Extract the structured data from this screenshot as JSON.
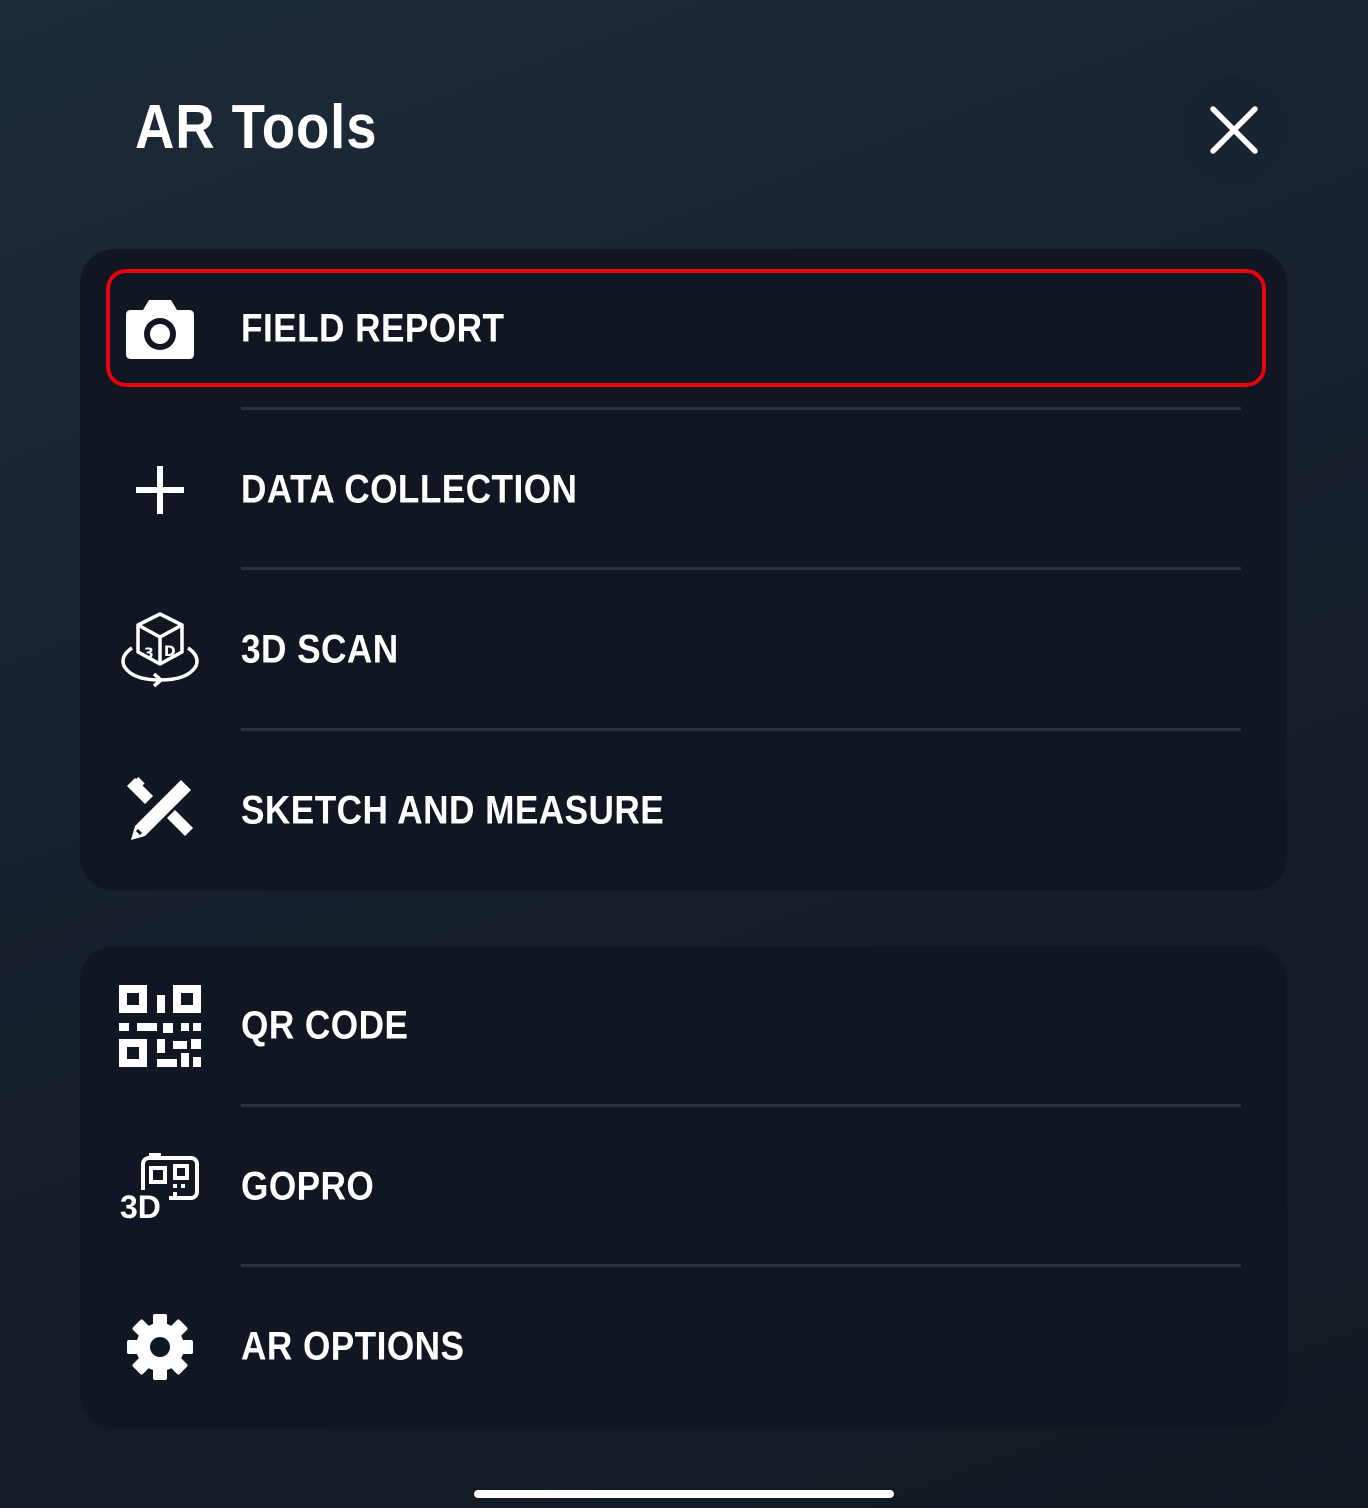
{
  "header": {
    "title": "AR Tools",
    "close_icon": "close-icon"
  },
  "highlight_color": "#e8000b",
  "groups": [
    {
      "items": [
        {
          "label": "FIELD REPORT",
          "icon": "camera-icon",
          "highlighted": true
        },
        {
          "label": "DATA COLLECTION",
          "icon": "plus-icon"
        },
        {
          "label": "3D SCAN",
          "icon": "3d-cube-rotate-icon"
        },
        {
          "label": "SKETCH AND MEASURE",
          "icon": "pencil-ruler-icon"
        }
      ]
    },
    {
      "items": [
        {
          "label": "QR CODE",
          "icon": "qr-code-icon"
        },
        {
          "label": "GOPRO",
          "icon": "gopro-3d-camera-icon"
        },
        {
          "label": "AR OPTIONS",
          "icon": "gear-icon"
        }
      ]
    }
  ]
}
